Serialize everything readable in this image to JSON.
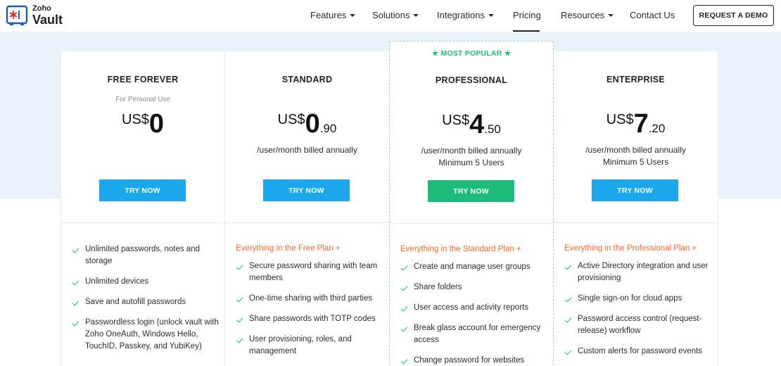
{
  "brand": {
    "zoho": "Zoho",
    "vault": "Vault",
    "accent": "#e42527"
  },
  "nav": {
    "items": [
      {
        "label": "Features",
        "dropdown": true
      },
      {
        "label": "Solutions",
        "dropdown": true
      },
      {
        "label": "Integrations",
        "dropdown": true
      },
      {
        "label": "Pricing",
        "dropdown": false,
        "active": true
      },
      {
        "label": "Resources",
        "dropdown": true
      },
      {
        "label": "Contact Us",
        "dropdown": false
      }
    ],
    "demo_label": "REQUEST A DEMO"
  },
  "colors": {
    "blue_button": "#1aa7ec",
    "green_button": "#1ebc7b",
    "orange_text": "#f26b2a",
    "band": "#e9f2fb"
  },
  "plans": [
    {
      "name": "FREE FOREVER",
      "subtitle": "For Personal Use",
      "currency": "US$",
      "price_int": "0",
      "price_dec": "",
      "billing": "",
      "minimum": "",
      "cta": "TRY NOW",
      "inherits": "",
      "features": [
        "Unlimited passwords, notes and storage",
        "Unlimited devices",
        "Save and autofill passwords",
        "Passwordless login (unlock vault with Zoho OneAuth, Windows Hello, TouchID, Passkey, and YubiKey)"
      ]
    },
    {
      "name": "STANDARD",
      "subtitle": "",
      "currency": "US$",
      "price_int": "0",
      "price_dec": ".90",
      "billing": "/user/month billed annually",
      "minimum": "",
      "cta": "TRY NOW",
      "inherits": "Everything in the Free Plan +",
      "features": [
        "Secure password sharing with team members",
        "One-time sharing with third parties",
        "Share passwords with TOTP codes",
        "User provisioning, roles, and management"
      ]
    },
    {
      "name": "PROFESSIONAL",
      "tag": "★ MOST POPULAR ★",
      "subtitle": "",
      "currency": "US$",
      "price_int": "4",
      "price_dec": ".50",
      "billing": "/user/month billed annually",
      "minimum": "Minimum 5 Users",
      "cta": "TRY NOW",
      "inherits": "Everything in the Standard Plan +",
      "features": [
        "Create and manage user groups",
        "Share folders",
        "User access and activity reports",
        "Break glass account for emergency access",
        "Change password for websites"
      ]
    },
    {
      "name": "ENTERPRISE",
      "subtitle": "",
      "currency": "US$",
      "price_int": "7",
      "price_dec": ".20",
      "billing": "/user/month billed annually",
      "minimum": "Minimum 5 Users",
      "cta": "TRY NOW",
      "inherits": "Everything in the Professional Plan +",
      "features": [
        "Active Directory integration and user provisioning",
        "Single sign-on for cloud apps",
        "Password access control (request-release) workflow",
        "Custom alerts for password events"
      ]
    }
  ]
}
